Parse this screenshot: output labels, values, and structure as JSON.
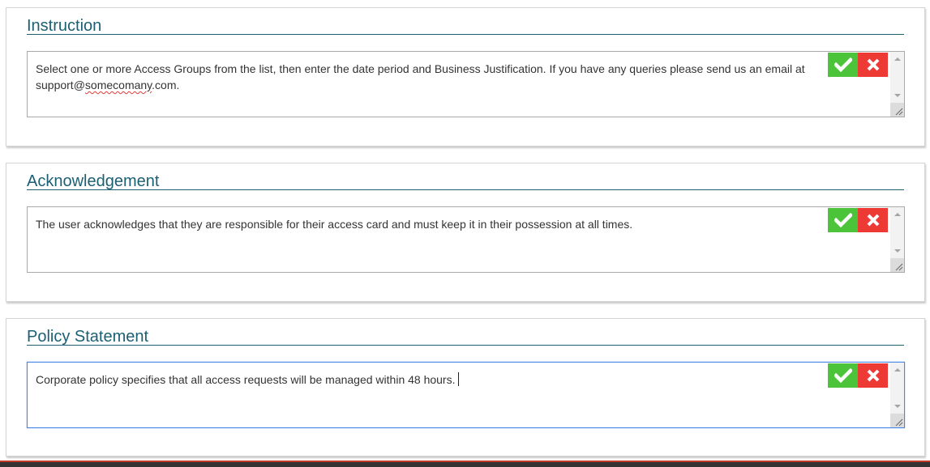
{
  "sections": [
    {
      "title": "Instruction",
      "text_before_link": "Select one or more Access Groups from the list, then enter the date period and Business Justification. If you have any queries please send us an email at support@",
      "text_link_misspelled": "somecomany",
      "text_after_link": ".com.",
      "accept_icon": "checkmark-icon",
      "cancel_icon": "close-x-icon"
    },
    {
      "title": "Acknowledgement",
      "text": "The user acknowledges that they are responsible for their access card and must keep it in their possession at all times.",
      "accept_icon": "checkmark-icon",
      "cancel_icon": "close-x-icon"
    },
    {
      "title": "Policy Statement",
      "text": "Corporate policy specifies that all access requests will be managed within 48 hours.",
      "accept_icon": "checkmark-icon",
      "cancel_icon": "close-x-icon",
      "focused": true
    }
  ],
  "colors": {
    "title": "#1b5f73",
    "accept": "#4cc43a",
    "cancel": "#ee3a34",
    "focus_border": "#4a86e8"
  }
}
